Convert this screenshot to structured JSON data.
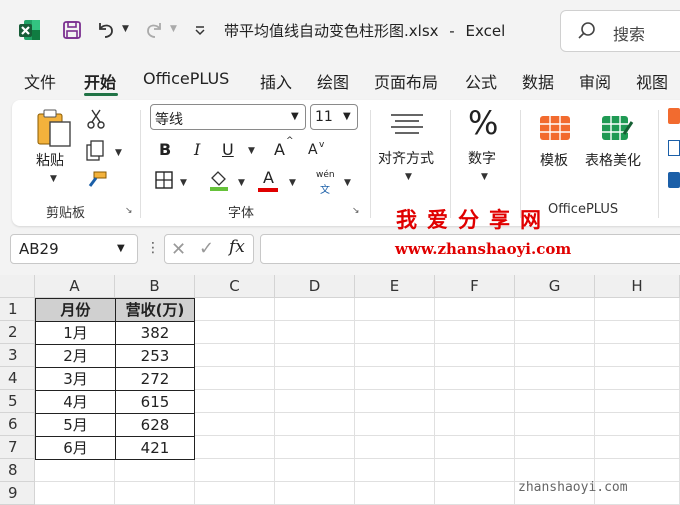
{
  "title_bar": {
    "filename": "带平均值线自动变色柱形图.xlsx",
    "separator": "-",
    "app_name": "Excel",
    "search_label": "搜索"
  },
  "menu": {
    "tabs": [
      "文件",
      "开始",
      "OfficePLUS",
      "插入",
      "绘图",
      "页面布局",
      "公式",
      "数据",
      "审阅",
      "视图"
    ],
    "active": "开始"
  },
  "ribbon": {
    "clipboard": {
      "paste_label": "粘贴",
      "group_label": "剪贴板"
    },
    "font": {
      "font_name": "等线",
      "font_size": "11",
      "group_label": "字体",
      "bold": "B",
      "italic": "I",
      "underline": "U",
      "phonetic_top": "wén",
      "phonetic_bottom": "文",
      "font_color_letter": "A",
      "grow_letter": "A",
      "shrink_letter": "A"
    },
    "alignment": {
      "label": "对齐方式"
    },
    "number": {
      "label": "数字"
    },
    "officeplus": {
      "template_label": "模板",
      "beautify_label": "表格美化",
      "group_label": "OfficePLUS"
    }
  },
  "formula_bar": {
    "name_box": "AB29",
    "fx": "fx",
    "content": ""
  },
  "watermark": {
    "line1": "我爱分享网",
    "line2": "www.zhanshaoyi.com",
    "line3": "zhanshaoyi.com"
  },
  "sheet": {
    "columns": [
      "A",
      "B",
      "C",
      "D",
      "E",
      "F",
      "G",
      "H"
    ],
    "rows": [
      "1",
      "2",
      "3",
      "4",
      "5",
      "6",
      "7",
      "8",
      "9"
    ],
    "table": {
      "headers": [
        "月份",
        "营收(万)"
      ],
      "data": [
        [
          "1月",
          "382"
        ],
        [
          "2月",
          "253"
        ],
        [
          "3月",
          "272"
        ],
        [
          "4月",
          "615"
        ],
        [
          "5月",
          "628"
        ],
        [
          "6月",
          "421"
        ]
      ]
    }
  },
  "colors": {
    "accent": "#217346",
    "watermark": "#e00000",
    "header_fill": "#d0d0d0"
  }
}
